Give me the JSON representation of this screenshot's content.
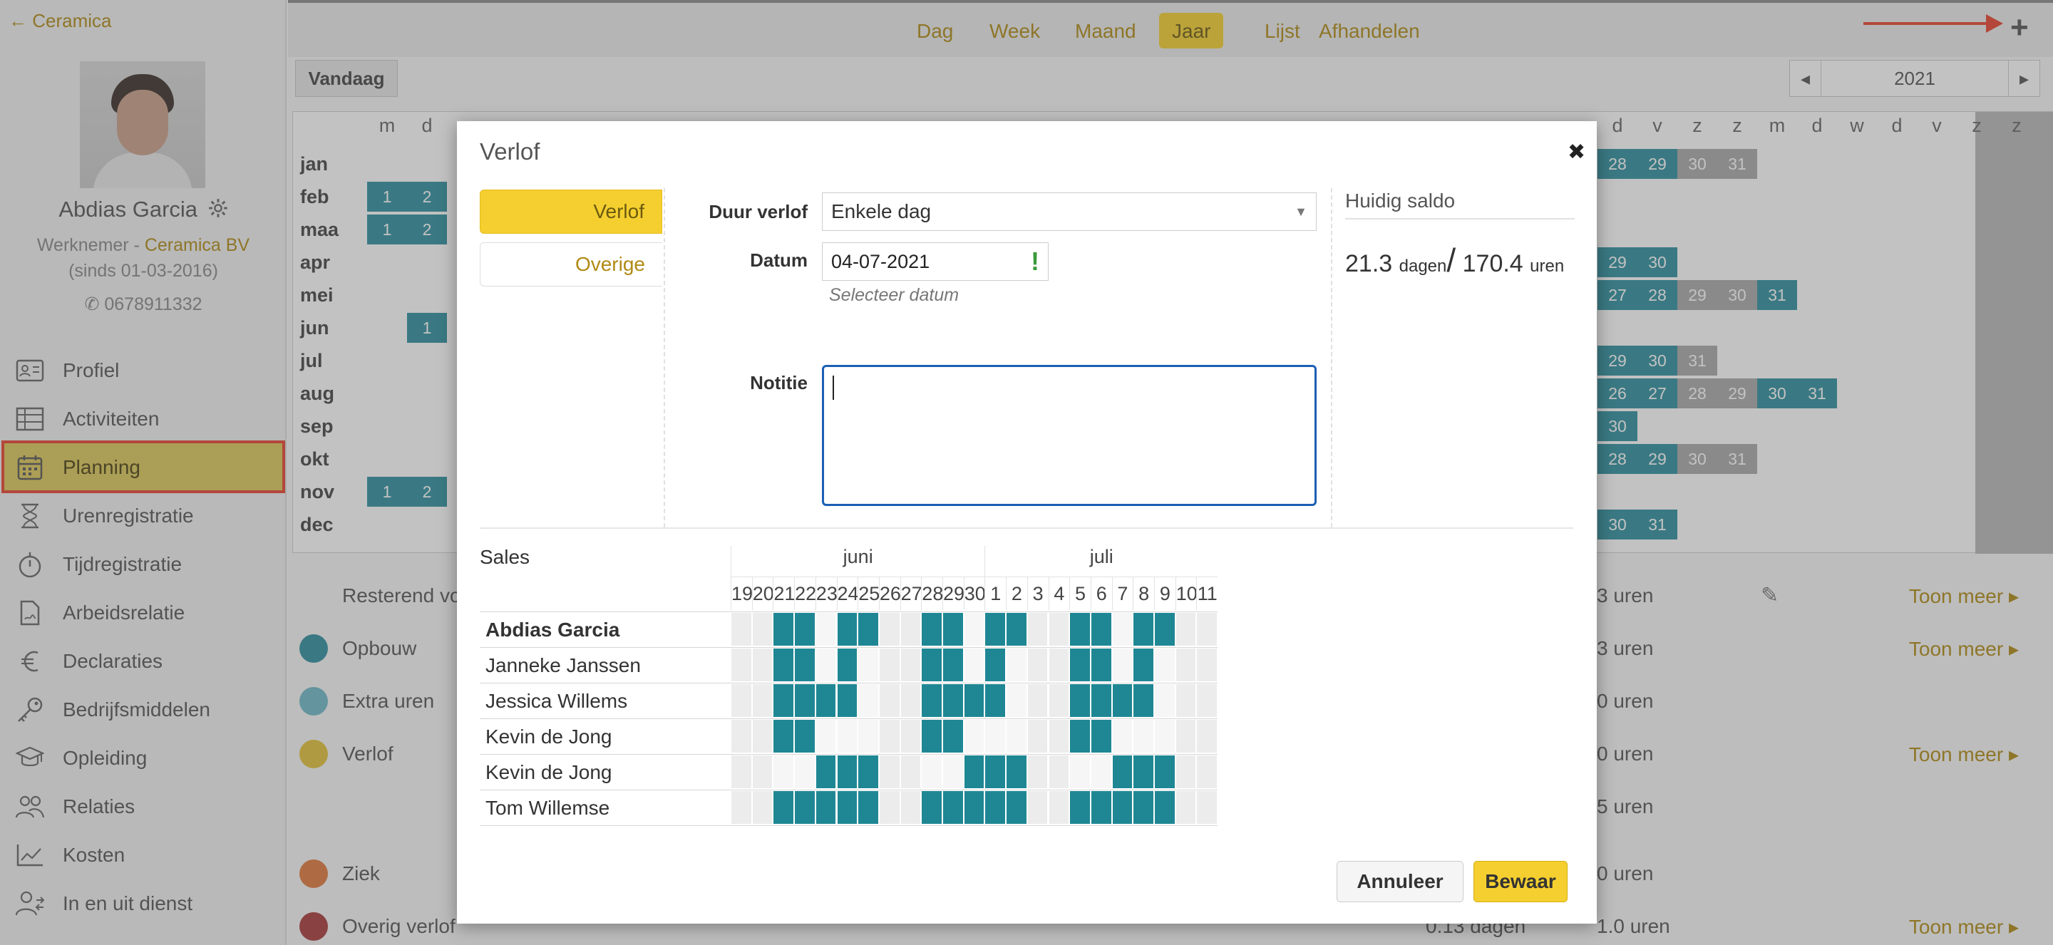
{
  "sidebar": {
    "back_label": "← Ceramica",
    "user": {
      "name": "Abdias Garcia",
      "role": "Werknemer - ",
      "company": "Ceramica BV",
      "since": "(sinds 01-03-2016)",
      "phone": "0678911332"
    },
    "items": [
      {
        "label": "Profiel",
        "icon": "profile-card-icon"
      },
      {
        "label": "Activiteiten",
        "icon": "table-icon"
      },
      {
        "label": "Planning",
        "icon": "calendar-icon",
        "active": true
      },
      {
        "label": "Urenregistratie",
        "icon": "hourglass-icon"
      },
      {
        "label": "Tijdregistratie",
        "icon": "stopwatch-icon"
      },
      {
        "label": "Arbeidsrelatie",
        "icon": "document-icon"
      },
      {
        "label": "Declaraties",
        "icon": "euro-icon"
      },
      {
        "label": "Bedrijfsmiddelen",
        "icon": "key-icon"
      },
      {
        "label": "Opleiding",
        "icon": "graduation-cap-icon"
      },
      {
        "label": "Relaties",
        "icon": "people-icon"
      },
      {
        "label": "Kosten",
        "icon": "line-chart-icon"
      },
      {
        "label": "In en uit dienst",
        "icon": "user-change-icon"
      }
    ]
  },
  "topbar": {
    "tabs": [
      "Dag",
      "Week",
      "Maand",
      "Jaar",
      "Lijst",
      "Afhandelen"
    ],
    "active_tab": "Jaar",
    "add_label": "+",
    "today_label": "Vandaag",
    "year": "2021",
    "prev_label": "◂",
    "next_label": "▸"
  },
  "background": {
    "weekday_headers_left": [
      "m",
      "d"
    ],
    "weekday_headers_right": [
      "d",
      "v",
      "z",
      "z",
      "m",
      "d",
      "w",
      "d",
      "v",
      "z",
      "z"
    ],
    "months": [
      "jan",
      "feb",
      "maa",
      "apr",
      "mei",
      "jun",
      "jul",
      "aug",
      "sep",
      "okt",
      "nov",
      "dec"
    ],
    "left_days": {
      "feb": [
        "1",
        "2"
      ],
      "maa": [
        "1",
        "2"
      ],
      "jun": [
        "",
        "1"
      ],
      "nov": [
        "1",
        "2"
      ]
    },
    "right_days": {
      "jan": [
        [
          "28",
          "teal"
        ],
        [
          "29",
          "teal"
        ],
        [
          "30",
          "grey"
        ],
        [
          "31",
          "grey"
        ]
      ],
      "apr": [
        [
          "29",
          "teal"
        ],
        [
          "30",
          "teal"
        ]
      ],
      "mei": [
        [
          "27",
          "teal"
        ],
        [
          "28",
          "teal"
        ],
        [
          "29",
          "grey"
        ],
        [
          "30",
          "grey"
        ],
        [
          "31",
          "teal"
        ]
      ],
      "jul": [
        [
          "29",
          "teal"
        ],
        [
          "30",
          "teal"
        ],
        [
          "31",
          "grey"
        ]
      ],
      "aug": [
        [
          "26",
          "teal"
        ],
        [
          "27",
          "teal"
        ],
        [
          "28",
          "grey"
        ],
        [
          "29",
          "grey"
        ],
        [
          "30",
          "teal"
        ],
        [
          "31",
          "teal"
        ]
      ],
      "sep": [
        [
          "30",
          "teal"
        ]
      ],
      "okt": [
        [
          "28",
          "teal"
        ],
        [
          "29",
          "teal"
        ],
        [
          "30",
          "grey"
        ],
        [
          "31",
          "grey"
        ]
      ],
      "dec": [
        [
          "30",
          "teal"
        ],
        [
          "31",
          "teal"
        ]
      ]
    },
    "summary": [
      {
        "label": "Resterend vo",
        "value": "3 uren",
        "dot": "",
        "toon": "Toon meer ▸",
        "edit": true
      },
      {
        "label": "Opbouw",
        "value": "3 uren",
        "dot": "#2f8f9f",
        "toon": "Toon meer ▸"
      },
      {
        "label": "Extra uren",
        "value": "0 uren",
        "dot": "#6fb8c8",
        "toon": ""
      },
      {
        "label": "Verlof",
        "value": "0 uren",
        "dot": "#e3c23a",
        "toon": "Toon meer ▸"
      },
      {
        "label": "",
        "value": "5 uren",
        "dot": "",
        "toon": ""
      },
      {
        "label": "Ziek",
        "value": "0 uren",
        "dot": "#e07a3c",
        "toon": ""
      },
      {
        "label": "Overig verlof",
        "value": "1.0 uren",
        "extra": "0.13 dagen",
        "dot": "#a83a3a",
        "toon": "Toon meer ▸"
      }
    ]
  },
  "modal": {
    "title": "Verlof",
    "close_label": "✖",
    "tabs": [
      "Verlof",
      "Overige"
    ],
    "fields": {
      "duur_label": "Duur verlof",
      "duur_value": "Enkele dag",
      "datum_label": "Datum",
      "datum_value": "04-07-2021",
      "datum_hint": "Selecteer datum",
      "notitie_label": "Notitie",
      "notitie_value": ""
    },
    "saldo": {
      "title": "Huidig saldo",
      "days": "21.3",
      "days_unit": "dagen",
      "separator": "/",
      "hours": "170.4",
      "hours_unit": "uren"
    },
    "team": {
      "group_label": "Sales",
      "months": [
        {
          "label": "juni",
          "span": 12
        },
        {
          "label": "juli",
          "span": 11
        }
      ],
      "days": [
        "19",
        "20",
        "21",
        "22",
        "23",
        "24",
        "25",
        "26",
        "27",
        "28",
        "29",
        "30",
        "1",
        "2",
        "3",
        "4",
        "5",
        "6",
        "7",
        "8",
        "9",
        "10",
        "11"
      ],
      "weekend_index": [
        0,
        1,
        7,
        8,
        14,
        15,
        21,
        22
      ],
      "members": [
        {
          "name": "Abdias Garcia",
          "bold": true,
          "days": [
            0,
            0,
            1,
            1,
            0,
            1,
            1,
            0,
            0,
            1,
            1,
            0,
            1,
            1,
            0,
            0,
            1,
            1,
            0,
            1,
            1,
            0,
            0
          ]
        },
        {
          "name": "Janneke Janssen",
          "bold": false,
          "days": [
            0,
            0,
            1,
            1,
            0,
            1,
            0,
            0,
            0,
            1,
            1,
            0,
            1,
            0,
            0,
            0,
            1,
            1,
            0,
            1,
            0,
            0,
            0
          ]
        },
        {
          "name": "Jessica Willems",
          "bold": false,
          "days": [
            0,
            0,
            1,
            1,
            1,
            1,
            0,
            0,
            0,
            1,
            1,
            1,
            1,
            0,
            0,
            0,
            1,
            1,
            1,
            1,
            0,
            0,
            0
          ]
        },
        {
          "name": "Kevin de Jong",
          "bold": false,
          "days": [
            0,
            0,
            1,
            1,
            0,
            0,
            0,
            0,
            0,
            1,
            1,
            0,
            0,
            0,
            0,
            0,
            1,
            1,
            0,
            0,
            0,
            0,
            0
          ]
        },
        {
          "name": "Kevin de Jong",
          "bold": false,
          "days": [
            0,
            0,
            0,
            0,
            1,
            1,
            1,
            0,
            0,
            0,
            0,
            1,
            1,
            1,
            0,
            0,
            0,
            0,
            1,
            1,
            1,
            0,
            0
          ]
        },
        {
          "name": "Tom Willemse",
          "bold": false,
          "days": [
            0,
            0,
            1,
            1,
            1,
            1,
            1,
            0,
            0,
            1,
            1,
            1,
            1,
            1,
            0,
            0,
            1,
            1,
            1,
            1,
            1,
            0,
            0
          ]
        }
      ]
    },
    "buttons": {
      "cancel": "Annuleer",
      "save": "Bewaar"
    }
  },
  "colors": {
    "accent": "#f5cf2f",
    "teal": "#2f8f9f",
    "link": "#b08a14",
    "highlight": "#e8432e"
  }
}
